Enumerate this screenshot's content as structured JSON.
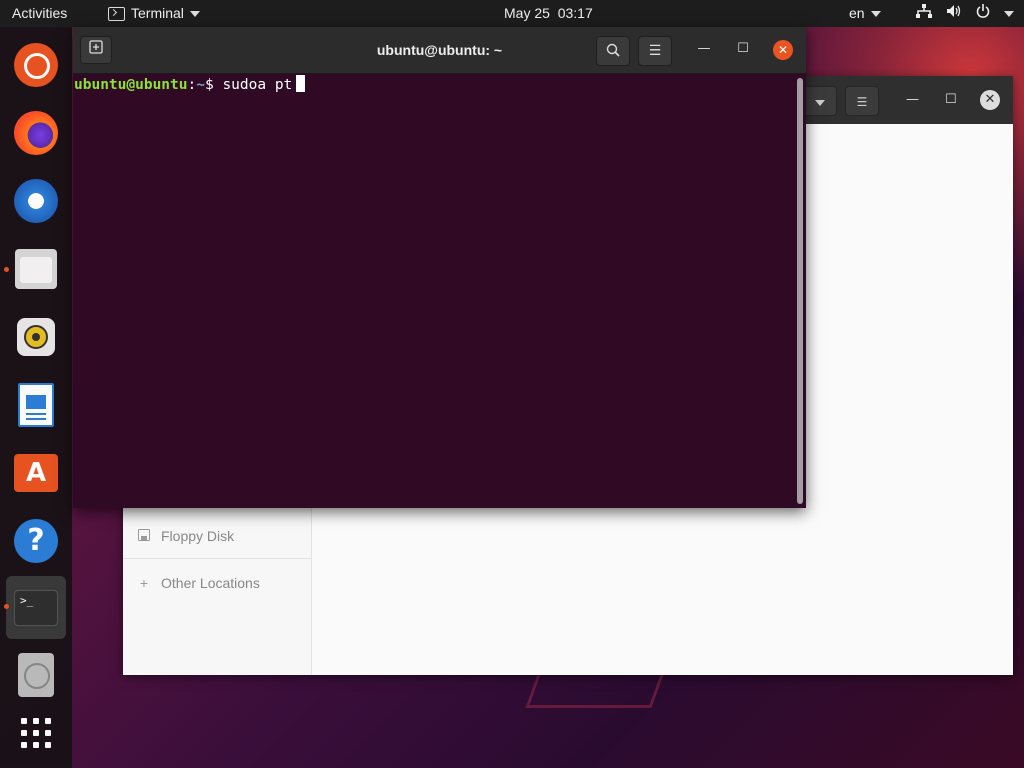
{
  "topbar": {
    "activities": "Activities",
    "app_menu_label": "Terminal",
    "clock": "May 25  03:17",
    "language": "en"
  },
  "dock": {
    "items": [
      {
        "name": "ubuntu-icon"
      },
      {
        "name": "firefox-icon"
      },
      {
        "name": "thunderbird-icon"
      },
      {
        "name": "files-icon",
        "running": true
      },
      {
        "name": "rhythmbox-icon"
      },
      {
        "name": "libreoffice-writer-icon"
      },
      {
        "name": "ubuntu-software-icon"
      },
      {
        "name": "help-icon"
      },
      {
        "name": "terminal-icon",
        "running": true,
        "active": true
      },
      {
        "name": "optical-drive-icon"
      },
      {
        "name": "show-applications-icon"
      }
    ],
    "terminal_glyph": ">_",
    "store_glyph": "A",
    "help_glyph": "?"
  },
  "terminal": {
    "title": "ubuntu@ubuntu: ~",
    "prompt_user": "ubuntu@ubuntu",
    "prompt_sep": ":",
    "prompt_path": "~",
    "prompt_symbol": "$ ",
    "command": "sudoa pt"
  },
  "files": {
    "sidebar": [
      {
        "label": "Floppy Disk",
        "icon": "floppy-icon"
      },
      {
        "label": "Other Locations",
        "icon": "plus-icon"
      }
    ]
  },
  "colors": {
    "accent": "#e95420",
    "terminal_bg": "#300a24",
    "prompt_user": "#8ae234",
    "prompt_path": "#729fcf"
  }
}
